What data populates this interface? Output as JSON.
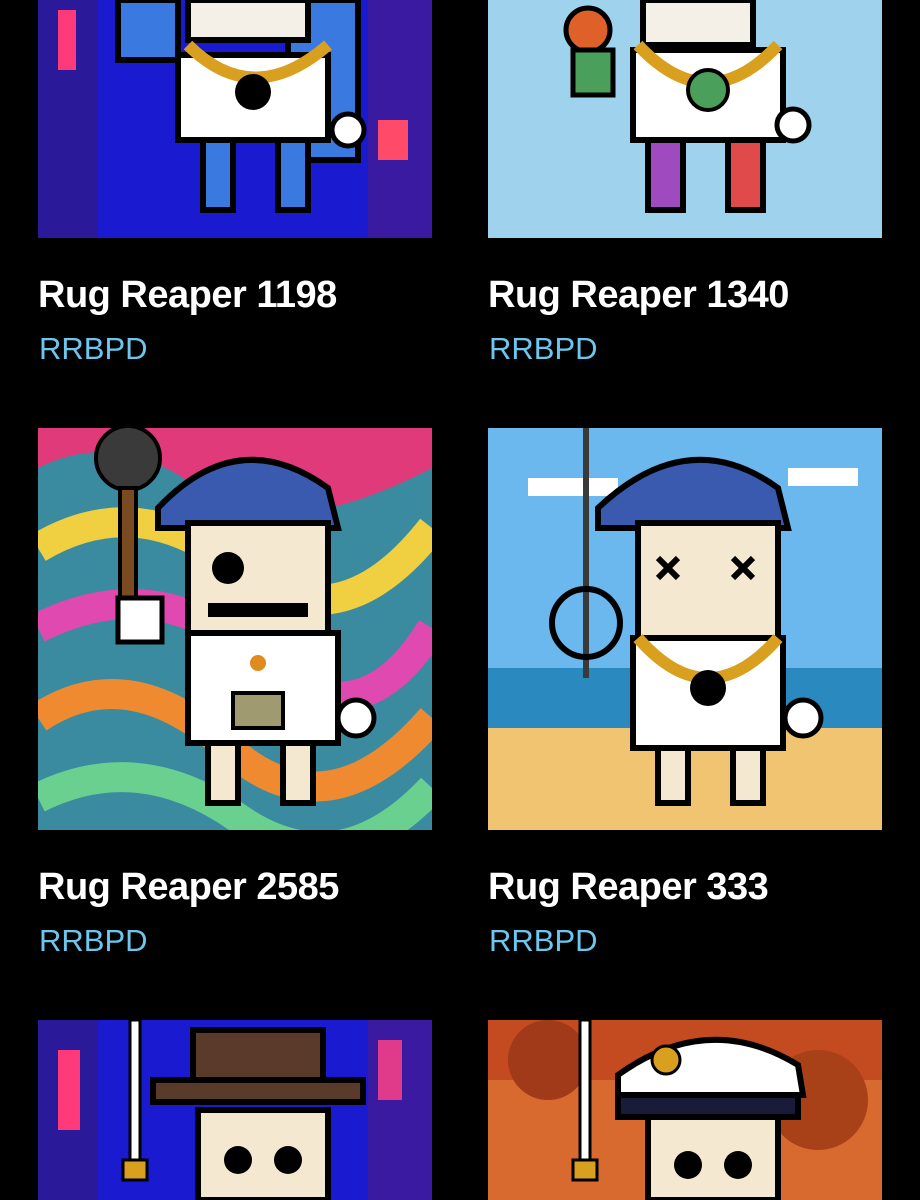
{
  "items": [
    {
      "name": "Rug Reaper 1198",
      "collection": "RRBPD",
      "art": "cyberpunk city skeleton with gold chain, skull pendant"
    },
    {
      "name": "Rug Reaper 1340",
      "collection": "RRBPD",
      "art": "sky blue skeleton with dollar pendant, tie-dye limbs"
    },
    {
      "name": "Rug Reaper 2585",
      "collection": "RRBPD",
      "art": "psychedelic swirl skeleton with blue cap and spiked mace"
    },
    {
      "name": "Rug Reaper 333",
      "collection": "RRBPD",
      "art": "beach skeleton with blue cap and hook staff"
    },
    {
      "name": "",
      "collection": "",
      "art": "neon city skeleton with brown fedora and sword"
    },
    {
      "name": "",
      "collection": "",
      "art": "orange sky skeleton with captain hat and sword"
    }
  ],
  "colors": {
    "background": "#000000",
    "title": "#ffffff",
    "collection": "#6cc7ee"
  }
}
